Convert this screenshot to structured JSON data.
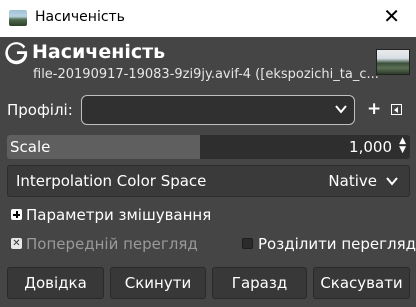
{
  "window": {
    "title": "Насиченість",
    "close_glyph": "✕"
  },
  "header": {
    "title": "Насиченість",
    "subtitle": "file-20190917-19083-9zi9jy.avif-4 ([ekspozichi_ta_c...",
    "icon": "gimp-g-icon"
  },
  "profiles": {
    "label": "Профілі:",
    "value": ""
  },
  "scale": {
    "label": "Scale",
    "value": "1,000",
    "fill_fraction": 0.48
  },
  "interpolation": {
    "label": "Interpolation Color Space",
    "value": "Native"
  },
  "blending": {
    "label": "Параметри змішування"
  },
  "preview": {
    "label": "Попередній перегляд",
    "checked": true,
    "enabled": false
  },
  "split_view": {
    "label": "Розділити перегляд",
    "checked": false
  },
  "buttons": {
    "help": "Довідка",
    "reset": "Скинути",
    "ok": "Гаразд",
    "cancel": "Скасувати"
  },
  "colors": {
    "background": "#454545",
    "field": "#2e2e2e",
    "fill": "#5f5f5f",
    "text": "#ffffff",
    "disabled": "#9a9a9a"
  }
}
